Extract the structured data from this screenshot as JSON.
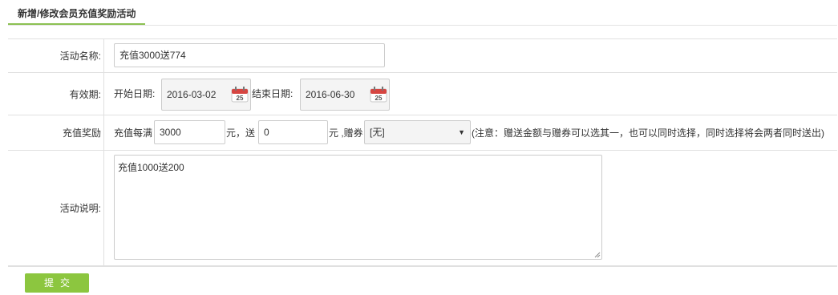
{
  "tab": {
    "title": "新增/修改会员充值奖励活动"
  },
  "form": {
    "name": {
      "label": "活动名称:",
      "value": "充值3000送774"
    },
    "validity": {
      "label": "有效期:",
      "start_label": "开始日期:",
      "start_value": "2016-03-02",
      "end_label": "结束日期:",
      "end_value": "2016-06-30",
      "calendar_day": "25"
    },
    "reward": {
      "label": "充值奖励",
      "prefix": "充值每满",
      "amount": "3000",
      "unit_give": "元，送",
      "gift_amount": "0",
      "unit_coupon": "元 ,赠券",
      "coupon_selected": "[无]",
      "note": "(注意：赠送金额与赠券可以选其一，也可以同时选择，同时选择将会两者同时送出)"
    },
    "description": {
      "label": "活动说明:",
      "value": "充值1000送200"
    }
  },
  "submit": {
    "label": "提交"
  },
  "colors": {
    "accent": "#8cc63f",
    "tab_underline": "#8cc152",
    "calendar_red": "#d64541"
  }
}
